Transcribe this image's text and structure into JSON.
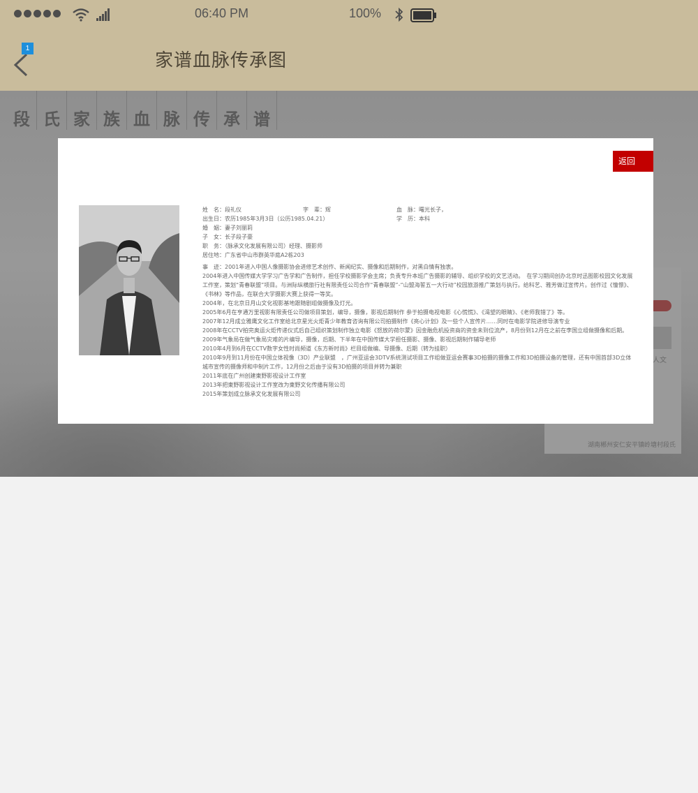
{
  "status_bar": {
    "time": "06:40 PM",
    "battery": "100%",
    "icons": [
      "signal-dots-icon",
      "wifi-icon",
      "cellular-signal-icon",
      "bluetooth-icon",
      "battery-icon"
    ]
  },
  "nav": {
    "title": "家谱血脉传承图",
    "badge": "1",
    "back_icon": "chevron-left-icon"
  },
  "banner": {
    "chars": [
      "段",
      "氏",
      "家",
      "族",
      "血",
      "脉",
      "传",
      "承",
      "谱"
    ]
  },
  "background": {
    "side_text": "人文",
    "footer": "湖南郴州安仁安平镇岭塘村段氏"
  },
  "modal": {
    "return_label": "返回",
    "rows": [
      {
        "a": "姓　名：段礼仪",
        "b": "字　辈：辉",
        "c": "血　脉：曙光长子，"
      },
      {
        "a": "出生日：农历1985年3月3日（公历1985.04.21）",
        "b": "",
        "c": "学　历：本科"
      },
      {
        "a": "婚　姻：妻子刘丽莉",
        "b": "",
        "c": ""
      },
      {
        "a": "子　女：长子段子豪",
        "b": "",
        "c": ""
      },
      {
        "a": "职　务：（脉承文化发展有限公司）经理、摄影师",
        "b": "",
        "c": ""
      },
      {
        "a": "居住地：广东省中山市群英华庭A2栋203",
        "b": "",
        "c": ""
      }
    ],
    "story": [
      "事　迹：2001年进入中国人像摄影协会进修艺术创作、新闻纪实、摄像和后期制作，对黑白情有独衷。",
      "2004年进入中国传媒大学学习广告学和广告制作，担任学校摄影学会主席；负责专升本班广告摄影的辅导、组织学校的文艺活动。　在学习期间创办北京时迅图影校园文化发展工作室，策划“青春联盟”项目。与洲际纵横旅行社有限责任公司合作“青春联盟”-“山盟海誓五一大行动”校园旅游推广策划与执行。给科艺、雅芳做过宣传片。创作过《憧憬》、《书林》等作品，在联合大学摄影大赛上获得一等奖。",
      "2004年，在北京日月山文化视影基地跟随剧组做摄像及灯光。",
      "2005年6月在亨通万里视影有限责任公司做项目策划，编导，摄像，影视后期制作 参于拍摄电视电影《心慌慌》、《渴望的眼睛》、《老师我错了》等。",
      "2007年12月成立雅鹰文化工作室给北京星光火炬青少年教育咨询有限公司拍摄制作《亮心计划》及一些个人宣传片……同时在电影学院进修导演专业",
      "2008年在CCTV拍完奥运火炬传递仪式后自己组织策划制作独立电影《怒放的荷尔蒙》因金融危机投资商的资金未到位流产，8月份到12月在之前在李国立组做摄像和后期。",
      "2009年气象局在做气象局灾难的片编导，摄像，后期、下半年在中国传媒大学担任摄影、摄像、影视后期制作辅导老师",
      "2010年4月到6月在CCTV数字女性时尚频道《东方新时尚》栏目组做编、导摄像、后期（转为挂职）",
      "2010年9月到11月份在中国立体视像（3D）产业联盟　，广州亚运会3DTV系统测试项目工作组做亚运会赛事3D拍摄的摄像工作和3D拍摄设备的管理，还有中国首部3D立体城市宣传的摄像师和中制片工作，12月份之后由于没有3D拍摄的项目并转为兼职",
      "2011年底在广州创建東野影视设计工作室",
      "2013年把東野影视设计工作室改为東野文化传播有限公司",
      "2015年策划成立脉承文化发展有限公司"
    ]
  },
  "colors": {
    "nav_bg": "#c9bc9c",
    "accent_red": "#c20000",
    "badge_blue": "#1e8fdc"
  }
}
